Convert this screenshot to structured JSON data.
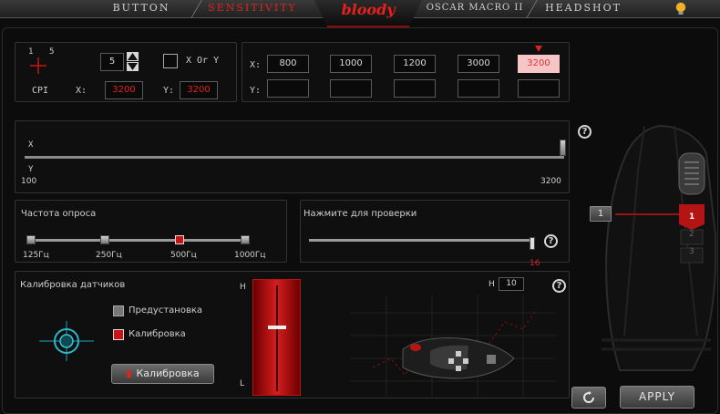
{
  "tabs": [
    {
      "label": "Button",
      "active": false
    },
    {
      "label": "Sensitivity",
      "active": true
    },
    {
      "label": "Oscar Macro II",
      "active": false
    },
    {
      "label": "Headshot",
      "active": false
    }
  ],
  "logo": "bloody",
  "cpi": {
    "axis_icon_labels": [
      "1",
      "5"
    ],
    "level_value": "5",
    "xory_label": "X Or Y",
    "cpi_label": "CPI",
    "x_label": "X:",
    "x_value": "3200",
    "y_label": "Y:",
    "y_value": "3200"
  },
  "presets": {
    "x_label": "X:",
    "y_label": "Y:",
    "x_values": [
      "800",
      "1000",
      "1200",
      "3000",
      "3200"
    ],
    "selected_index": 4
  },
  "slider": {
    "x_label": "X",
    "y_label": "Y",
    "min_label": "100",
    "max_label": "3200",
    "value": 3200
  },
  "polling": {
    "title": "Частота опроса",
    "options": [
      "125Гц",
      "250Гц",
      "500Гц",
      "1000Гц"
    ],
    "selected_index": 2
  },
  "test": {
    "title": "Нажмите для проверки",
    "value": "16"
  },
  "calibration": {
    "title": "Калибровка датчиков",
    "preset_label": "Предустановка",
    "calibrate_label": "Калибровка",
    "button_label": "Калибровка",
    "h_label": "H",
    "l_label": "L",
    "h_value": "10"
  },
  "mouse_side": {
    "key_badge": "1",
    "wheel_labels": [
      "1",
      "2",
      "3"
    ]
  },
  "footer": {
    "apply_label": "APPLY"
  },
  "colors": {
    "accent": "#e0241c",
    "bg": "#0c0c0c"
  }
}
